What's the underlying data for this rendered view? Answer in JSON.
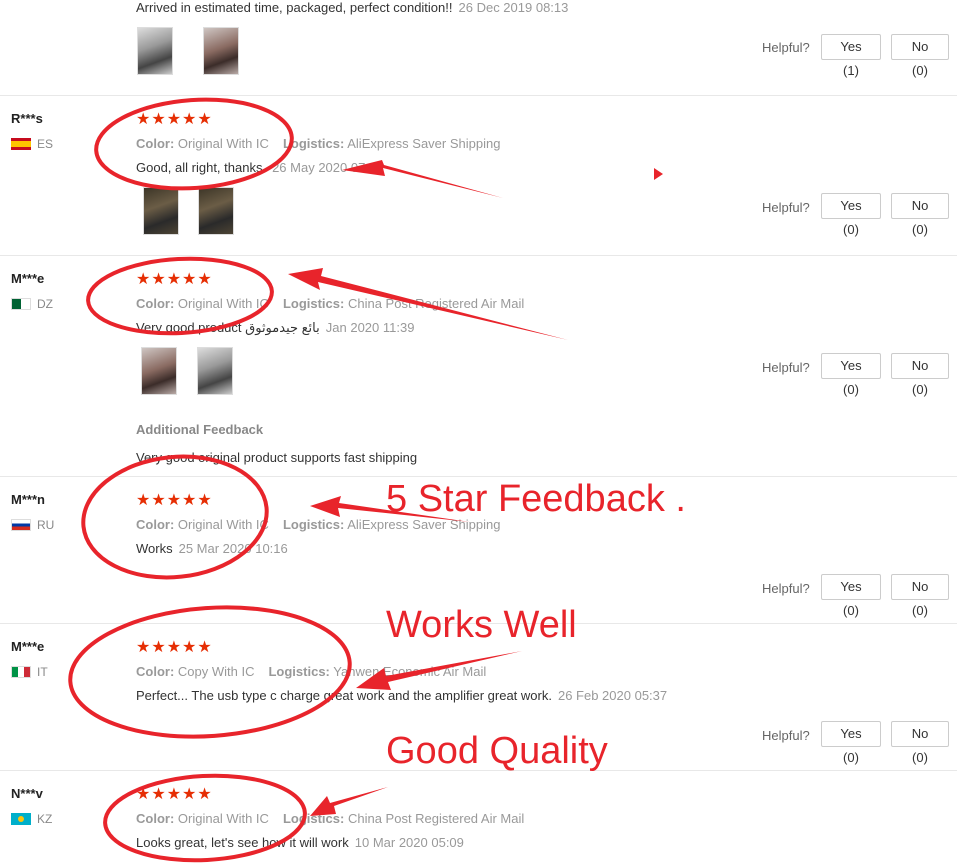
{
  "helpful_label": "Helpful?",
  "stars_glyph": "★★★★★",
  "accent_color": "#e62e04",
  "annotation_color": "#e8242b",
  "annotation_lines": [
    "5 Star Feedback .",
    "Works Well",
    "Good Quality"
  ],
  "reviews": [
    {
      "user": "",
      "country": "",
      "text": "Arrived in estimated time, packaged, perfect condition!!",
      "date": "26 Dec 2019 08:13",
      "yes": "Yes (1)",
      "no": "No (0)"
    },
    {
      "user": "R***s",
      "country": "ES",
      "color_label": "Color:",
      "color": "Original With IC",
      "logistics_label": "Logistics:",
      "logistics": "AliExpress Saver Shipping",
      "text": "Good, all right, thanks.",
      "date": "26 May 2020 07:59",
      "yes": "Yes (0)",
      "no": "No (0)"
    },
    {
      "user": "M***e",
      "country": "DZ",
      "color_label": "Color:",
      "color": "Original With IC",
      "logistics_label": "Logistics:",
      "logistics": "China Post Registered Air Mail",
      "text": "Very good product   بائع جيدموثوق",
      "date": "Jan 2020 11:39",
      "yes": "Yes (0)",
      "no": "No (0)",
      "additional_label": "Additional Feedback",
      "additional_text": "Very good original product supports fast shipping"
    },
    {
      "user": "M***n",
      "country": "RU",
      "color_label": "Color:",
      "color": "Original With IC",
      "logistics_label": "Logistics:",
      "logistics": "AliExpress Saver Shipping",
      "text": "Works",
      "date": "25 Mar 2020 10:16",
      "yes": "Yes (0)",
      "no": "No (0)"
    },
    {
      "user": "M***e",
      "country": "IT",
      "color_label": "Color:",
      "color": "Copy With IC",
      "logistics_label": "Logistics:",
      "logistics": "Yanwen Economic Air Mail",
      "text": "Perfect... The usb type c charge great work and the amplifier great work.",
      "date": "26 Feb 2020 05:37",
      "yes": "Yes (0)",
      "no": "No (0)"
    },
    {
      "user": "N***v",
      "country": "KZ",
      "color_label": "Color:",
      "color": "Original With IC",
      "logistics_label": "Logistics:",
      "logistics": "China Post Registered Air Mail",
      "text": "Looks great, let's see how it will work",
      "date": "10 Mar 2020 05:09"
    }
  ]
}
